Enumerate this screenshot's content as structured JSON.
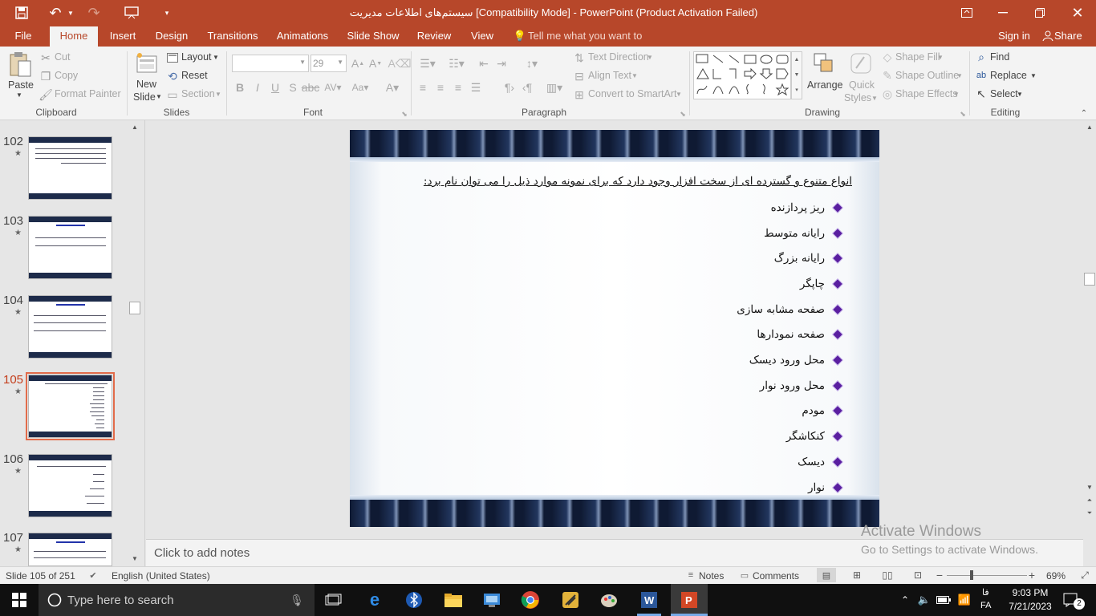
{
  "titlebar": {
    "title": "سیستم‌های اطلاعات مدیریت [Compatibility Mode] - PowerPoint (Product Activation Failed)"
  },
  "tabs": {
    "file": "File",
    "home": "Home",
    "insert": "Insert",
    "design": "Design",
    "transitions": "Transitions",
    "animations": "Animations",
    "slideshow": "Slide Show",
    "review": "Review",
    "view": "View",
    "tellme": "Tell me what you want to do...",
    "signin": "Sign in",
    "share": "Share"
  },
  "ribbon": {
    "clipboard": {
      "paste": "Paste",
      "cut": "Cut",
      "copy": "Copy",
      "format_painter": "Format Painter",
      "label": "Clipboard"
    },
    "slides": {
      "new_slide_1": "New",
      "new_slide_2": "Slide",
      "layout": "Layout",
      "reset": "Reset",
      "section": "Section",
      "label": "Slides"
    },
    "font": {
      "font_name": "",
      "font_size": "29",
      "label": "Font"
    },
    "paragraph": {
      "text_direction": "Text Direction",
      "align_text": "Align Text",
      "convert_smartart": "Convert to SmartArt",
      "label": "Paragraph"
    },
    "drawing": {
      "arrange": "Arrange",
      "quick_styles_1": "Quick",
      "quick_styles_2": "Styles",
      "shape_fill": "Shape Fill",
      "shape_outline": "Shape Outline",
      "shape_effects": "Shape Effects",
      "label": "Drawing"
    },
    "editing": {
      "find": "Find",
      "replace": "Replace",
      "select": "Select",
      "label": "Editing"
    }
  },
  "thumbnails": [
    {
      "num": "102",
      "selected": false
    },
    {
      "num": "103",
      "selected": false
    },
    {
      "num": "104",
      "selected": false
    },
    {
      "num": "105",
      "selected": true
    },
    {
      "num": "106",
      "selected": false
    },
    {
      "num": "107",
      "selected": false
    }
  ],
  "slide": {
    "heading": "انواع متنوع و گسترده ای از سخت افزار وجود دارد که برای نمونه موارد ذیل را می توان نام برد:",
    "bullets": [
      "ریز پردازنده",
      "رایانه متوسط",
      "رایانه بزرگ",
      "چاپگر",
      "صفحه مشابه سازی",
      "صفحه نمودارها",
      "محل ورود دیسک",
      "محل ورود نوار",
      "مودم",
      "کنکاشگر",
      "دیسک",
      "نوار"
    ]
  },
  "notes": {
    "placeholder": "Click to add notes"
  },
  "watermark": {
    "line1": "Activate Windows",
    "line2": "Go to Settings to activate Windows."
  },
  "status": {
    "slide_info": "Slide 105 of 251",
    "language": "English (United States)",
    "notes": "Notes",
    "comments": "Comments",
    "zoom": "69%"
  },
  "taskbar": {
    "search_placeholder": "Type here to search",
    "lang_1": "فا",
    "lang_2": "FA",
    "time": "9:03 PM",
    "date": "7/21/2023",
    "notif_count": "2"
  },
  "colors": {
    "accent": "#b7472a",
    "bullet": "#5a1fa0",
    "slide_band": "#0f1a33"
  }
}
